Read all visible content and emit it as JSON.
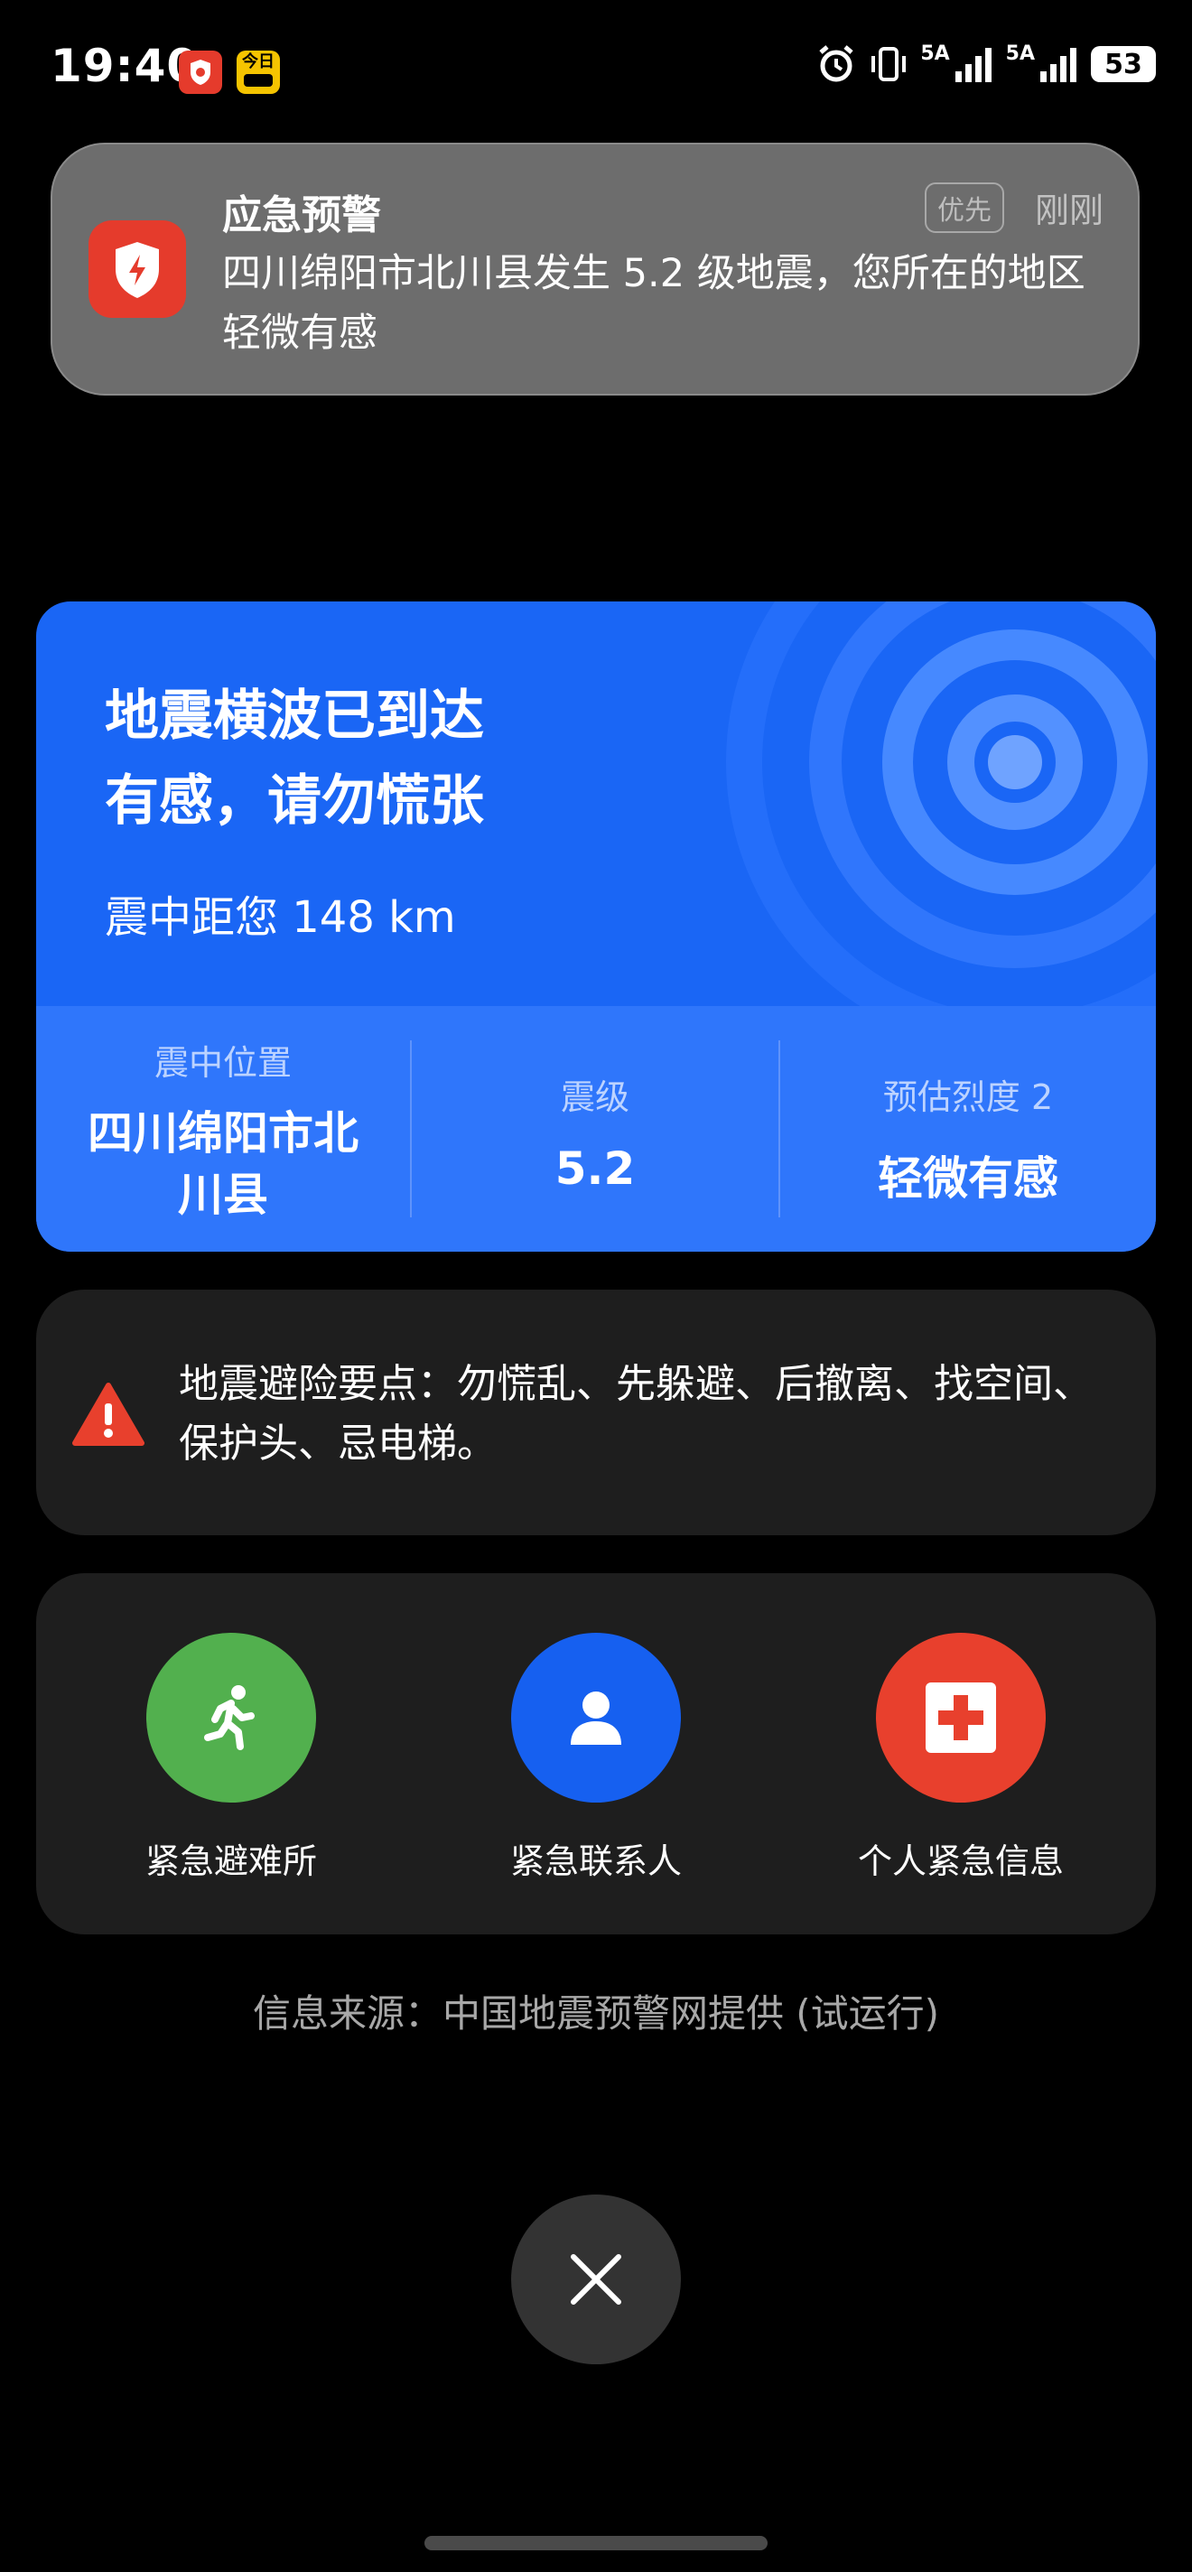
{
  "status_bar": {
    "time": "19:40",
    "badge_app_text": "今日",
    "net1": "5A",
    "net2": "5A",
    "battery": "53"
  },
  "notification": {
    "title": "应急预警",
    "tag": "优先",
    "time": "刚刚",
    "body": "四川绵阳市北川县发生 5.2 级地震，您所在的地区轻微有感"
  },
  "quake": {
    "headline_line1": "地震横波已到达",
    "headline_line2": "有感，请勿慌张",
    "distance": "震中距您 148 km",
    "epicenter_label": "震中位置",
    "epicenter_value_line1": "四川绵阳市北",
    "epicenter_value_line2": "川县",
    "magnitude_label": "震级",
    "magnitude_value": "5.2",
    "intensity_label": "预估烈度 2",
    "intensity_value": "轻微有感"
  },
  "tips": {
    "text": "地震避险要点：勿慌乱、先躲避、后撤离、找空间、保护头、忌电梯。"
  },
  "actions": [
    {
      "label": "紧急避难所",
      "color": "#52b04e",
      "icon": "running-person-icon"
    },
    {
      "label": "紧急联系人",
      "color": "#1660f0",
      "icon": "person-icon"
    },
    {
      "label": "个人紧急信息",
      "color": "#e8402d",
      "icon": "medical-cross-icon"
    }
  ],
  "source": "信息来源：中国地震预警网提供 (试运行)",
  "colors": {
    "card_blue": "#1a66f5",
    "alert_red": "#e53b2c",
    "background": "#000000"
  }
}
